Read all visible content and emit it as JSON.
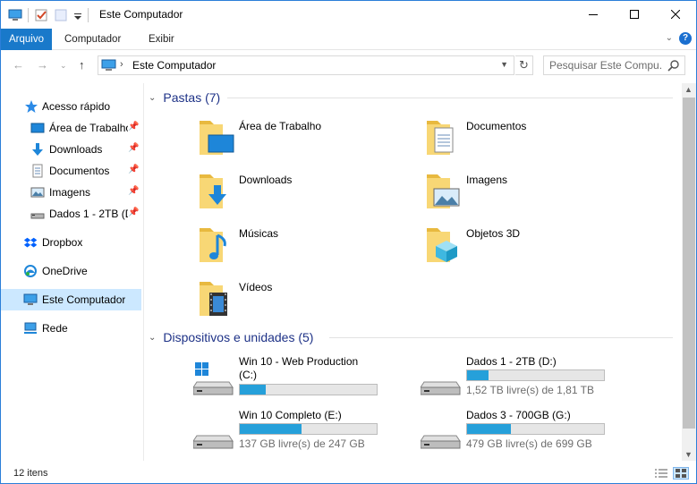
{
  "window": {
    "title": "Este Computador"
  },
  "ribbon": {
    "tabs": [
      "Arquivo",
      "Computador",
      "Exibir"
    ]
  },
  "address": {
    "crumb": "Este Computador",
    "search_placeholder": "Pesquisar Este Compu..."
  },
  "sidebar": {
    "items": [
      {
        "label": "Acesso rápido",
        "icon": "star-icon"
      },
      {
        "label": "Área de Trabalho",
        "icon": "desktop-icon",
        "pinned": true
      },
      {
        "label": "Downloads",
        "icon": "download-icon",
        "pinned": true
      },
      {
        "label": "Documentos",
        "icon": "document-icon",
        "pinned": true
      },
      {
        "label": "Imagens",
        "icon": "pictures-icon",
        "pinned": true
      },
      {
        "label": "Dados 1 - 2TB (D:)",
        "icon": "drive-icon",
        "pinned": true
      },
      {
        "label": "Dropbox",
        "icon": "dropbox-icon"
      },
      {
        "label": "OneDrive",
        "icon": "onedrive-icon"
      },
      {
        "label": "Este Computador",
        "icon": "computer-icon",
        "selected": true
      },
      {
        "label": "Rede",
        "icon": "network-icon"
      }
    ]
  },
  "folders": {
    "header": "Pastas (7)",
    "items": [
      {
        "label": "Área de Trabalho",
        "icon": "desktop-folder-icon"
      },
      {
        "label": "Documentos",
        "icon": "documents-folder-icon"
      },
      {
        "label": "Downloads",
        "icon": "downloads-folder-icon"
      },
      {
        "label": "Imagens",
        "icon": "pictures-folder-icon"
      },
      {
        "label": "Músicas",
        "icon": "music-folder-icon"
      },
      {
        "label": "Objetos 3D",
        "icon": "3d-objects-folder-icon"
      },
      {
        "label": "Vídeos",
        "icon": "videos-folder-icon"
      }
    ]
  },
  "devices": {
    "header": "Dispositivos e unidades (5)",
    "items": [
      {
        "name": "Win 10 - Web Production (C:)",
        "free": "",
        "used_fraction": 0.19,
        "windows": true
      },
      {
        "name": "Dados 1 - 2TB (D:)",
        "free": "1,52 TB livre(s) de 1,81 TB",
        "used_fraction": 0.16
      },
      {
        "name": "Win 10 Completo (E:)",
        "free": "137 GB livre(s) de 247 GB",
        "used_fraction": 0.45
      },
      {
        "name": "Dados 3 - 700GB (G:)",
        "free": "479 GB livre(s) de 699 GB",
        "used_fraction": 0.32
      }
    ]
  },
  "status": {
    "count": "12 itens"
  },
  "colors": {
    "accent": "#1979ca",
    "header_text": "#1e3287",
    "bar_fill": "#26a0da",
    "selection": "#cce8ff",
    "folder_yellow": "#f8d775"
  }
}
